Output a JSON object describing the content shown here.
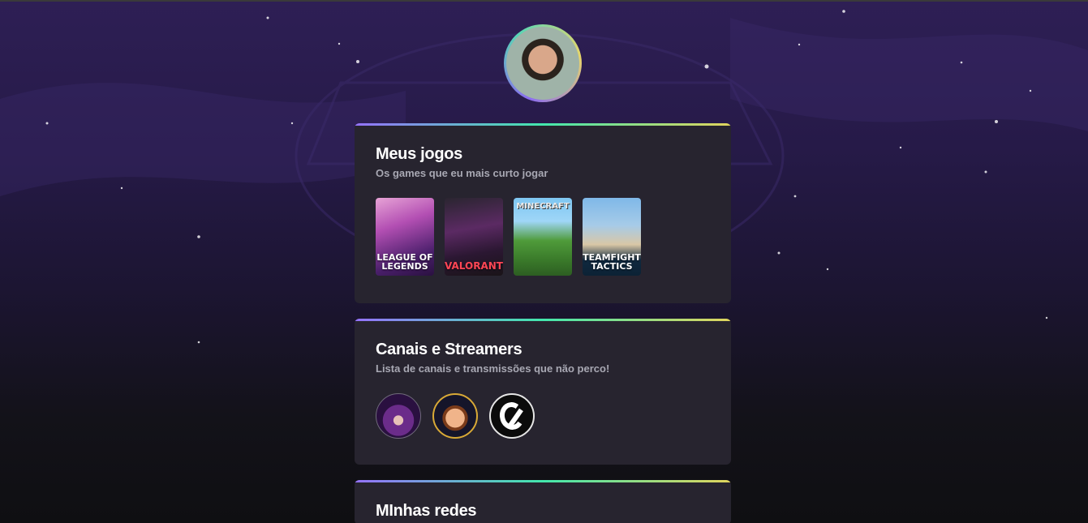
{
  "profile": {
    "avatar_icon": "profile-photo"
  },
  "games_card": {
    "title": "Meus jogos",
    "subtitle": "Os games que eu mais curto jogar",
    "games": [
      {
        "label": "LEAGUE OF LEGENDS",
        "icon": "league-of-legends-cover"
      },
      {
        "label": "VALORANT",
        "icon": "valorant-cover"
      },
      {
        "label": "MINECRAFT",
        "icon": "minecraft-cover"
      },
      {
        "label": "TEAMFIGHT TACTICS",
        "icon": "teamfight-tactics-cover"
      }
    ]
  },
  "streamers_card": {
    "title": "Canais e Streamers",
    "subtitle": "Lista de canais e transmissões que não perco!",
    "streamers": [
      {
        "icon": "streamer-avatar-1"
      },
      {
        "icon": "streamer-avatar-2"
      },
      {
        "icon": "streamer-avatar-3"
      }
    ]
  },
  "networks_card": {
    "title": "MInhas redes"
  },
  "colors": {
    "card_bg": "#27242f",
    "gradient_start": "#9572fc",
    "gradient_mid": "#43e7ad",
    "gradient_end": "#e1d55d",
    "subtitle": "#a8a8b3"
  }
}
